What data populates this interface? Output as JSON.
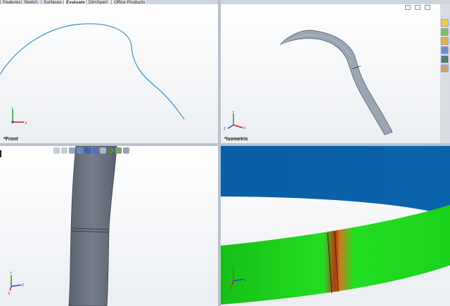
{
  "tabs": [
    {
      "label": "Features",
      "active": false
    },
    {
      "label": "Sketch",
      "active": false
    },
    {
      "label": "Surfaces",
      "active": false
    },
    {
      "label": "Evaluate",
      "active": true
    },
    {
      "label": "DimXpert",
      "active": false
    },
    {
      "label": "Office Products",
      "active": false
    }
  ],
  "viewports": {
    "front": {
      "label": "*Front"
    },
    "isometric": {
      "label": "*Isometric"
    }
  },
  "triad": {
    "x": "X",
    "y": "Y",
    "z": "Z"
  },
  "heads_up_toolbar": [
    "zoom-to-fit-icon",
    "zoom-to-area-icon",
    "previous-view-icon",
    "section-view-icon",
    "view-orientation-icon",
    "display-style-icon",
    "hide-show-items-icon",
    "edit-appearance-icon",
    "apply-scene-icon",
    "view-settings-icon"
  ],
  "task_pane": [
    "home-icon",
    "resources-icon",
    "design-library-icon",
    "file-explorer-icon",
    "appearances-icon",
    "custom-properties-icon"
  ],
  "window_controls": [
    "tile-icon",
    "restore-icon",
    "close-icon"
  ],
  "colors": {
    "curve": "#3a90c8",
    "sheet": "#6a7280",
    "zebra_green": "#1fd81f",
    "zebra_blue": "#0a5fa5",
    "zebra_red": "#b33a10"
  }
}
